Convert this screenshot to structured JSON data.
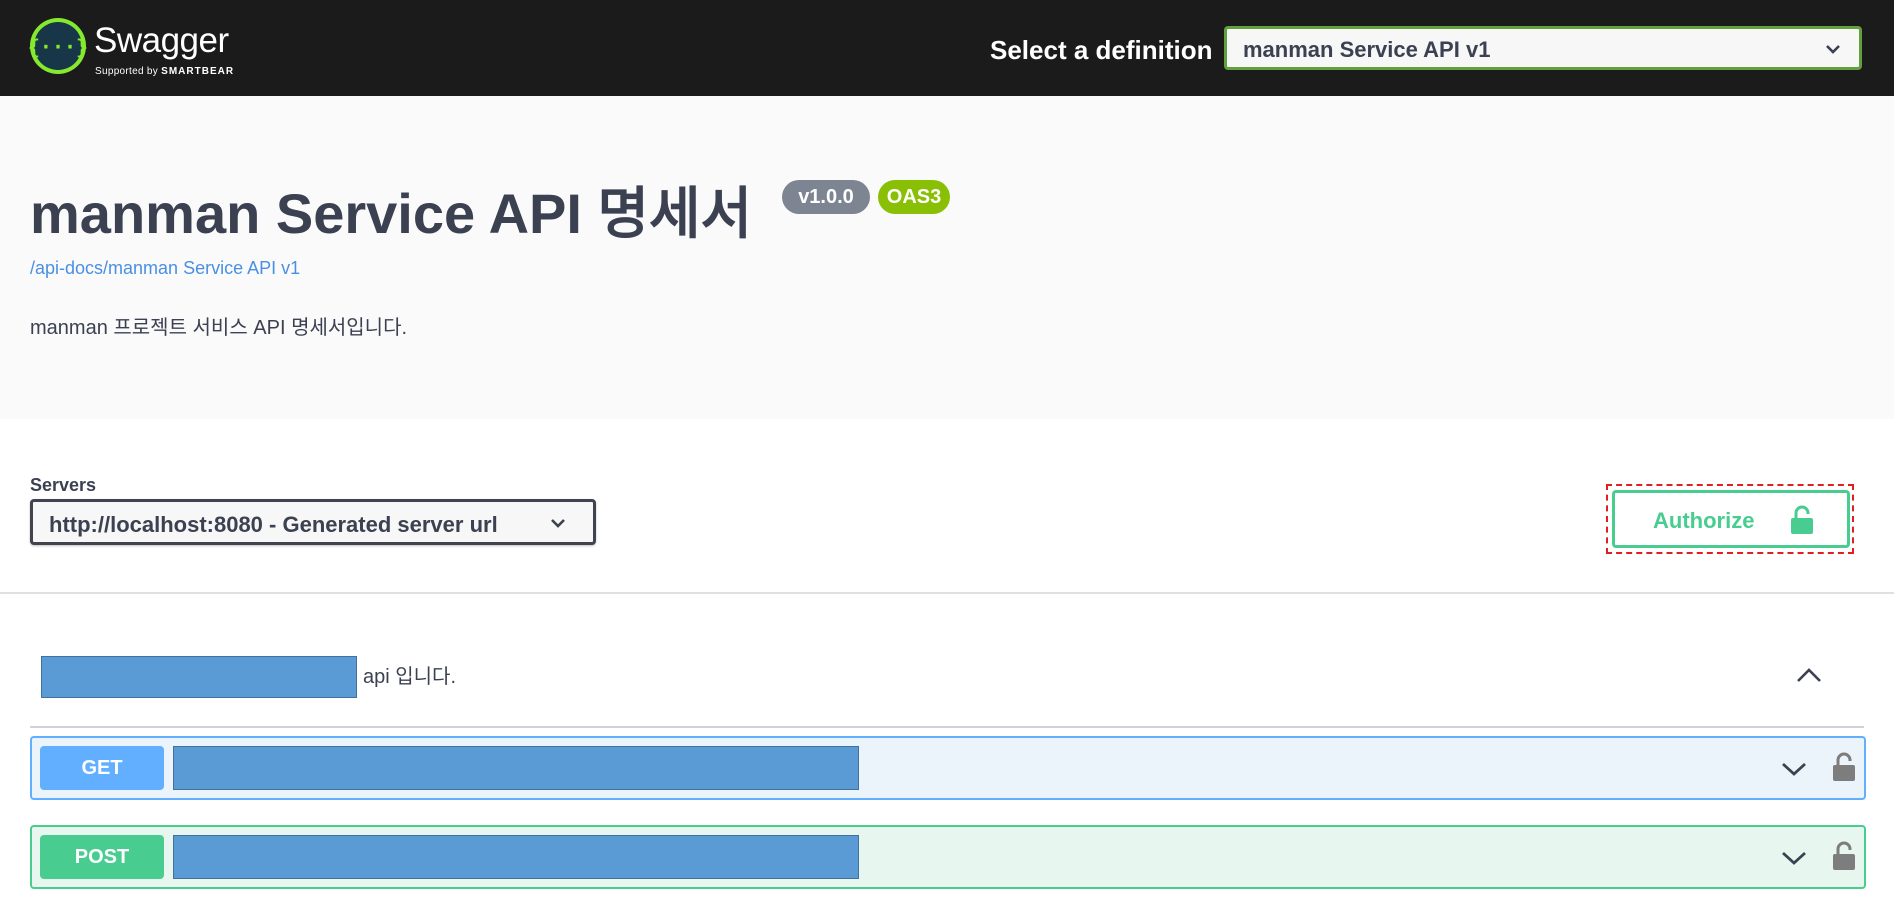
{
  "topbar": {
    "logo_text": "Swagger",
    "logo_sub_prefix": "Supported by ",
    "logo_sub_brand": "SMARTBEAR",
    "definition_label": "Select a definition",
    "definition_selected": "manman Service API v1"
  },
  "info": {
    "title": "manman Service API 명세서",
    "version_badge": "v1.0.0",
    "oas_badge": "OAS3",
    "spec_url": "/api-docs/manman Service API v1",
    "description": "manman 프로젝트 서비스 API 명세서입니다."
  },
  "servers": {
    "label": "Servers",
    "selected": "http://localhost:8080 - Generated server url"
  },
  "authorize": {
    "label": "Authorize"
  },
  "tag": {
    "description_suffix": "api 입니다."
  },
  "operations": [
    {
      "method": "GET"
    },
    {
      "method": "POST"
    }
  ],
  "colors": {
    "topbar_bg": "#1b1b1b",
    "logo_green": "#85ea2d",
    "get": "#61affe",
    "post": "#49cc90",
    "version_badge": "#7d8492",
    "oas_badge": "#89bf04",
    "link": "#4990e2",
    "redaction": "#5b9bd5",
    "highlight_outline": "#e02020"
  },
  "icons": {
    "logo": "swagger-braces-logo-icon",
    "definition_dropdown": "chevron-down-icon",
    "server_dropdown": "chevron-down-icon",
    "authorize": "unlocked-padlock-icon",
    "tag_toggle": "chevron-up-icon",
    "operation_toggle": "chevron-down-icon",
    "operation_lock": "unlocked-padlock-icon"
  }
}
